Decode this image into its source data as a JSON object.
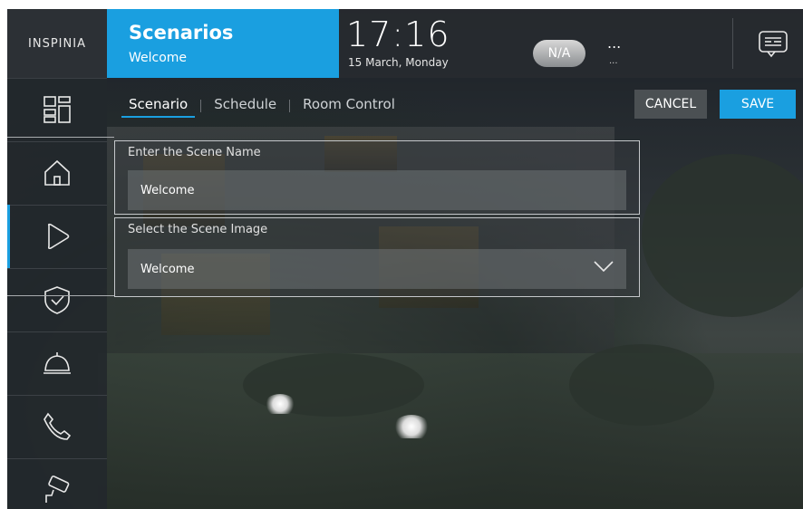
{
  "logo": {
    "text": "INSPINIA"
  },
  "header": {
    "title": "Scenarios",
    "subtitle": "Welcome",
    "time": "17:16",
    "date": "15 March, Monday",
    "weather_badge": "N/A",
    "weather_main": "...",
    "weather_sub": "..."
  },
  "tabs": [
    {
      "label": "Scenario",
      "active": true
    },
    {
      "label": "Schedule",
      "active": false
    },
    {
      "label": "Room Control",
      "active": false
    }
  ],
  "actions": {
    "cancel": "CANCEL",
    "save": "SAVE"
  },
  "form": {
    "name_label": "Enter the Scene Name",
    "name_value": "Welcome",
    "image_label": "Select the Scene Image",
    "image_value": "Welcome"
  },
  "sidebar": {
    "items": [
      {
        "icon": "dashboard-icon"
      },
      {
        "icon": "home-icon"
      },
      {
        "icon": "scenario-play-icon"
      },
      {
        "icon": "security-shield-icon"
      },
      {
        "icon": "service-bell-icon"
      },
      {
        "icon": "phone-icon"
      },
      {
        "icon": "camera-icon"
      }
    ]
  },
  "colors": {
    "accent": "#1a9fe0",
    "sidebar": "#23282d"
  }
}
